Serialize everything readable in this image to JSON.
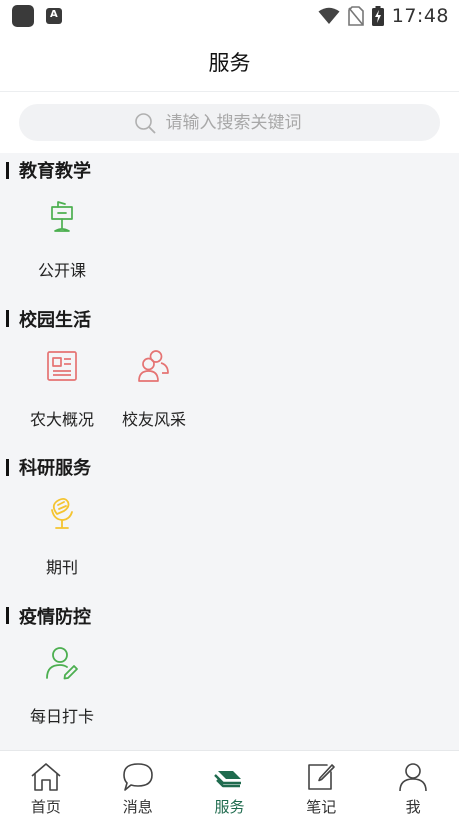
{
  "status_bar": {
    "time": "17:48"
  },
  "header": {
    "title": "服务"
  },
  "search": {
    "placeholder": "请输入搜索关键词"
  },
  "sections": [
    {
      "title": "教育教学",
      "items": [
        {
          "label": "公开课",
          "icon": "lectern-icon",
          "color": "#4caf50"
        }
      ]
    },
    {
      "title": "校园生活",
      "items": [
        {
          "label": "农大概况",
          "icon": "newspaper-icon",
          "color": "#e57373"
        },
        {
          "label": "校友风采",
          "icon": "users-icon",
          "color": "#e57373"
        }
      ]
    },
    {
      "title": "科研服务",
      "items": [
        {
          "label": "期刊",
          "icon": "microphone-icon",
          "color": "#f4c430"
        }
      ]
    },
    {
      "title": "疫情防控",
      "items": [
        {
          "label": "每日打卡",
          "icon": "user-edit-icon",
          "color": "#4caf50"
        }
      ]
    }
  ],
  "tabbar": {
    "active_color": "#1f6b4e",
    "tabs": [
      {
        "label": "首页",
        "icon": "home-icon",
        "active": false
      },
      {
        "label": "消息",
        "icon": "chat-bubble-icon",
        "active": false
      },
      {
        "label": "服务",
        "icon": "stack-icon",
        "active": true
      },
      {
        "label": "笔记",
        "icon": "edit-note-icon",
        "active": false
      },
      {
        "label": "我",
        "icon": "person-icon",
        "active": false
      }
    ]
  }
}
